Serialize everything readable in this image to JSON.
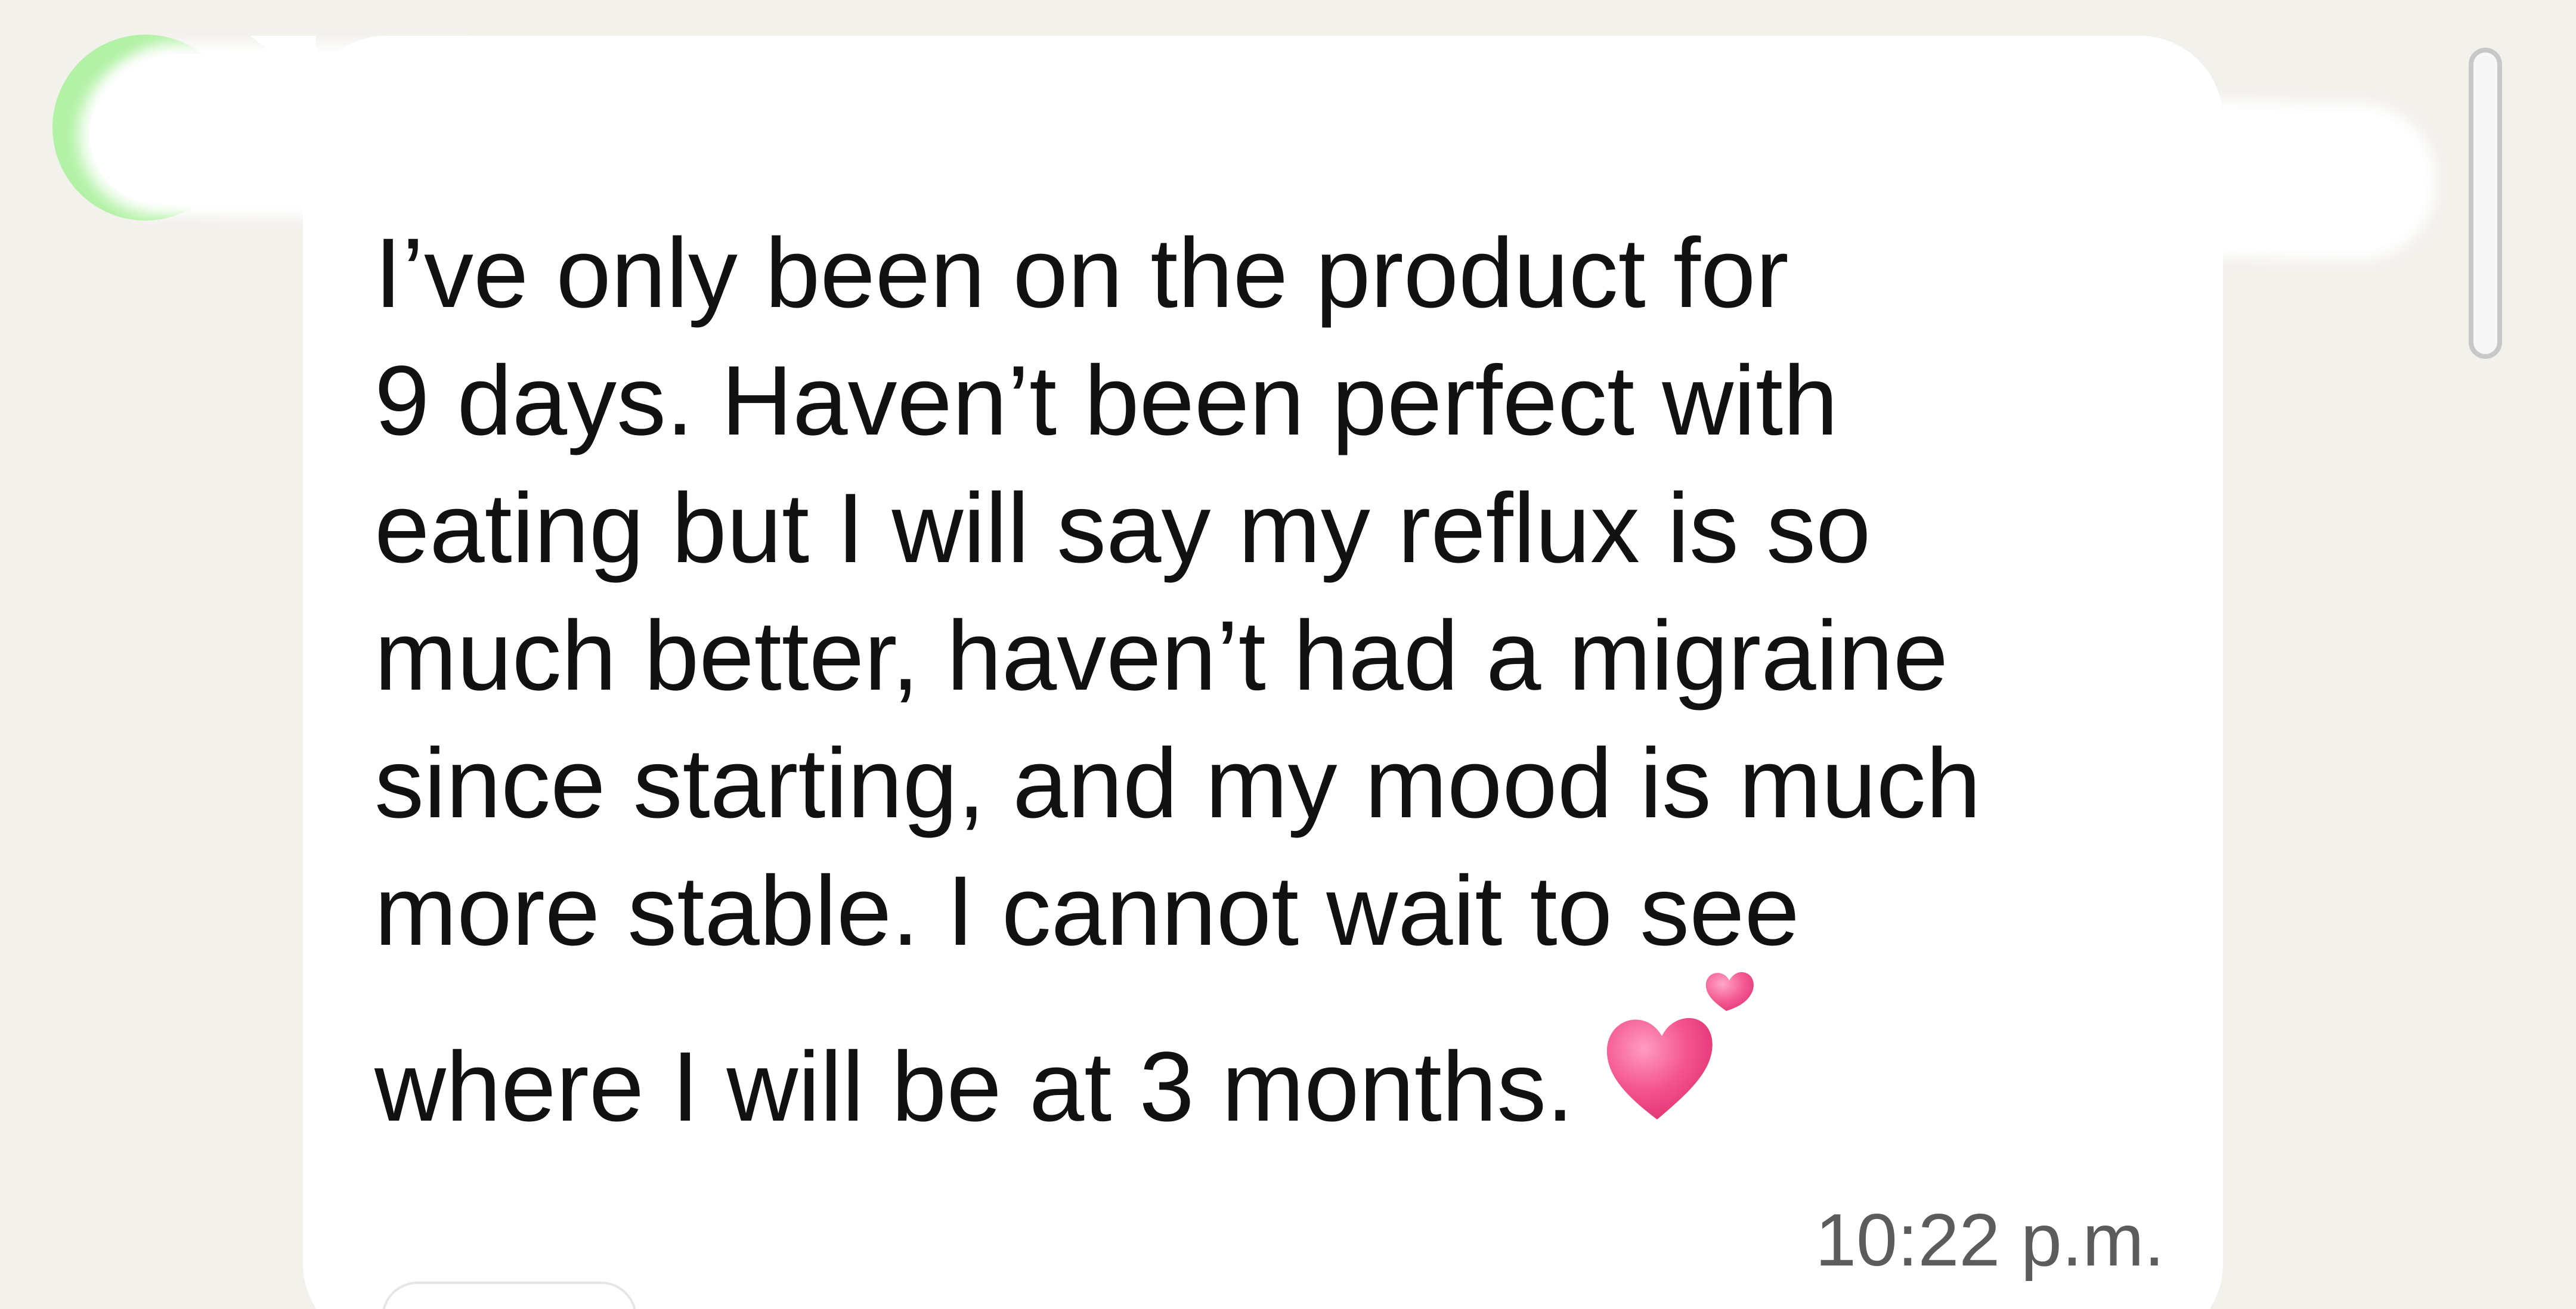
{
  "chat": {
    "sender_name": "",
    "sender_phone": "",
    "message_lines": [
      "I’ve only been on the product for",
      "9 days. Haven’t been perfect with",
      "eating but I will say my reflux is so",
      "much better, haven’t had a migraine",
      "since starting, and my mood is much",
      "more stable. I cannot wait to see",
      "where I will be at 3 months."
    ],
    "emoji": "two-hearts",
    "timestamp": "10:22 p.m."
  },
  "colors": {
    "background": "#f3f1ec",
    "bubble": "#ffffff",
    "avatar": "#b3f2a6",
    "sender_name": "#1f8c50",
    "heart": "#f3508f"
  }
}
